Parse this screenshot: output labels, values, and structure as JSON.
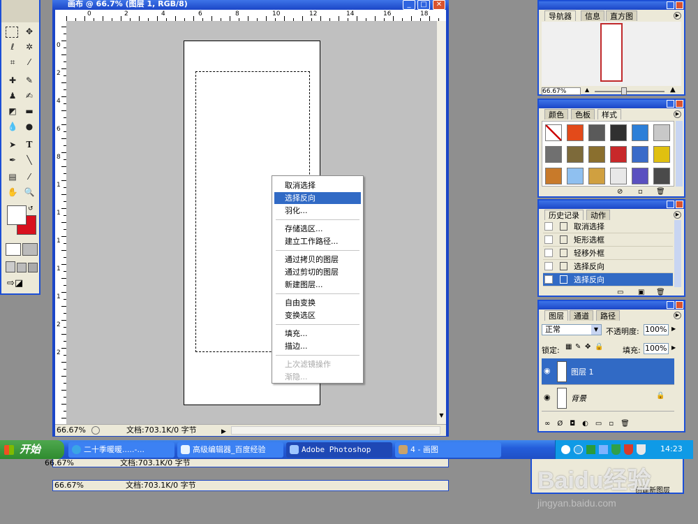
{
  "doc_window": {
    "title": "画布 @ 66.7% (图层 1, RGB/8)",
    "zoom": "66.67%",
    "doc_info": "文档:703.1K/0 字节",
    "ruler_top": [
      "0",
      "2",
      "4",
      "6",
      "8",
      "10",
      "12",
      "14",
      "16",
      "18"
    ],
    "ruler_left": [
      "0",
      "2",
      "4",
      "6",
      "8",
      "1",
      "1",
      "1",
      "1",
      "1",
      "2",
      "2"
    ]
  },
  "context_menu": {
    "items": [
      {
        "label": "取消选择",
        "state": "normal"
      },
      {
        "label": "选择反向",
        "state": "selected"
      },
      {
        "label": "羽化...",
        "state": "normal"
      },
      {
        "label": "存储选区...",
        "state": "normal"
      },
      {
        "label": "建立工作路径...",
        "state": "normal"
      },
      {
        "label": "通过拷贝的图层",
        "state": "normal"
      },
      {
        "label": "通过剪切的图层",
        "state": "normal"
      },
      {
        "label": "新建图层...",
        "state": "normal"
      },
      {
        "label": "自由变换",
        "state": "normal"
      },
      {
        "label": "变换选区",
        "state": "normal"
      },
      {
        "label": "填充...",
        "state": "normal"
      },
      {
        "label": "描边...",
        "state": "normal"
      },
      {
        "label": "上次滤镜操作",
        "state": "disabled"
      },
      {
        "label": "渐隐...",
        "state": "disabled"
      }
    ]
  },
  "navigator": {
    "tabs": [
      "导航器",
      "信息",
      "直方图"
    ],
    "zoom": "66.67%"
  },
  "swatches_panel": {
    "tabs": [
      "颜色",
      "色板",
      "样式"
    ],
    "style_colors": [
      "#ffffff",
      "#e34a1a",
      "#5a5a5a",
      "#303030",
      "#2c7fd8",
      "#c8c8c8",
      "#707070",
      "#7d6a3a",
      "#8a6f2e",
      "#c8282a",
      "#3a6bc9",
      "#e0c010",
      "#c87a2a",
      "#8fc0f0",
      "#d0a040",
      "#e8e8e8",
      "#5a50c0",
      "#4a4a4a"
    ]
  },
  "history_panel": {
    "tabs": [
      "历史记录",
      "动作"
    ],
    "items": [
      "取消选择",
      "矩形选框",
      "轻移外框",
      "选择反向",
      "选择反向"
    ]
  },
  "layers_panel": {
    "tabs": [
      "图层",
      "通道",
      "路径"
    ],
    "blend_mode": "正常",
    "opacity_label": "不透明度:",
    "opacity_value": "100%",
    "lock_label": "锁定:",
    "fill_label": "填充:",
    "fill_value": "100%",
    "layers": [
      "图层 1",
      "背景"
    ]
  },
  "taskbar": {
    "start_label": "开始",
    "buttons": [
      "二十季暖暖.....-...",
      "高级编辑器_百度经验",
      "Adobe Photoshop",
      "4 - 画图"
    ],
    "clock": "14:23"
  },
  "ghost_status": {
    "zoom": "66.67%",
    "doc_info": "文档:703.1K/0 字节",
    "new_layer": "创建新图层"
  },
  "watermark": {
    "text": "Baidu经验",
    "url": "jingyan.baidu.com"
  }
}
